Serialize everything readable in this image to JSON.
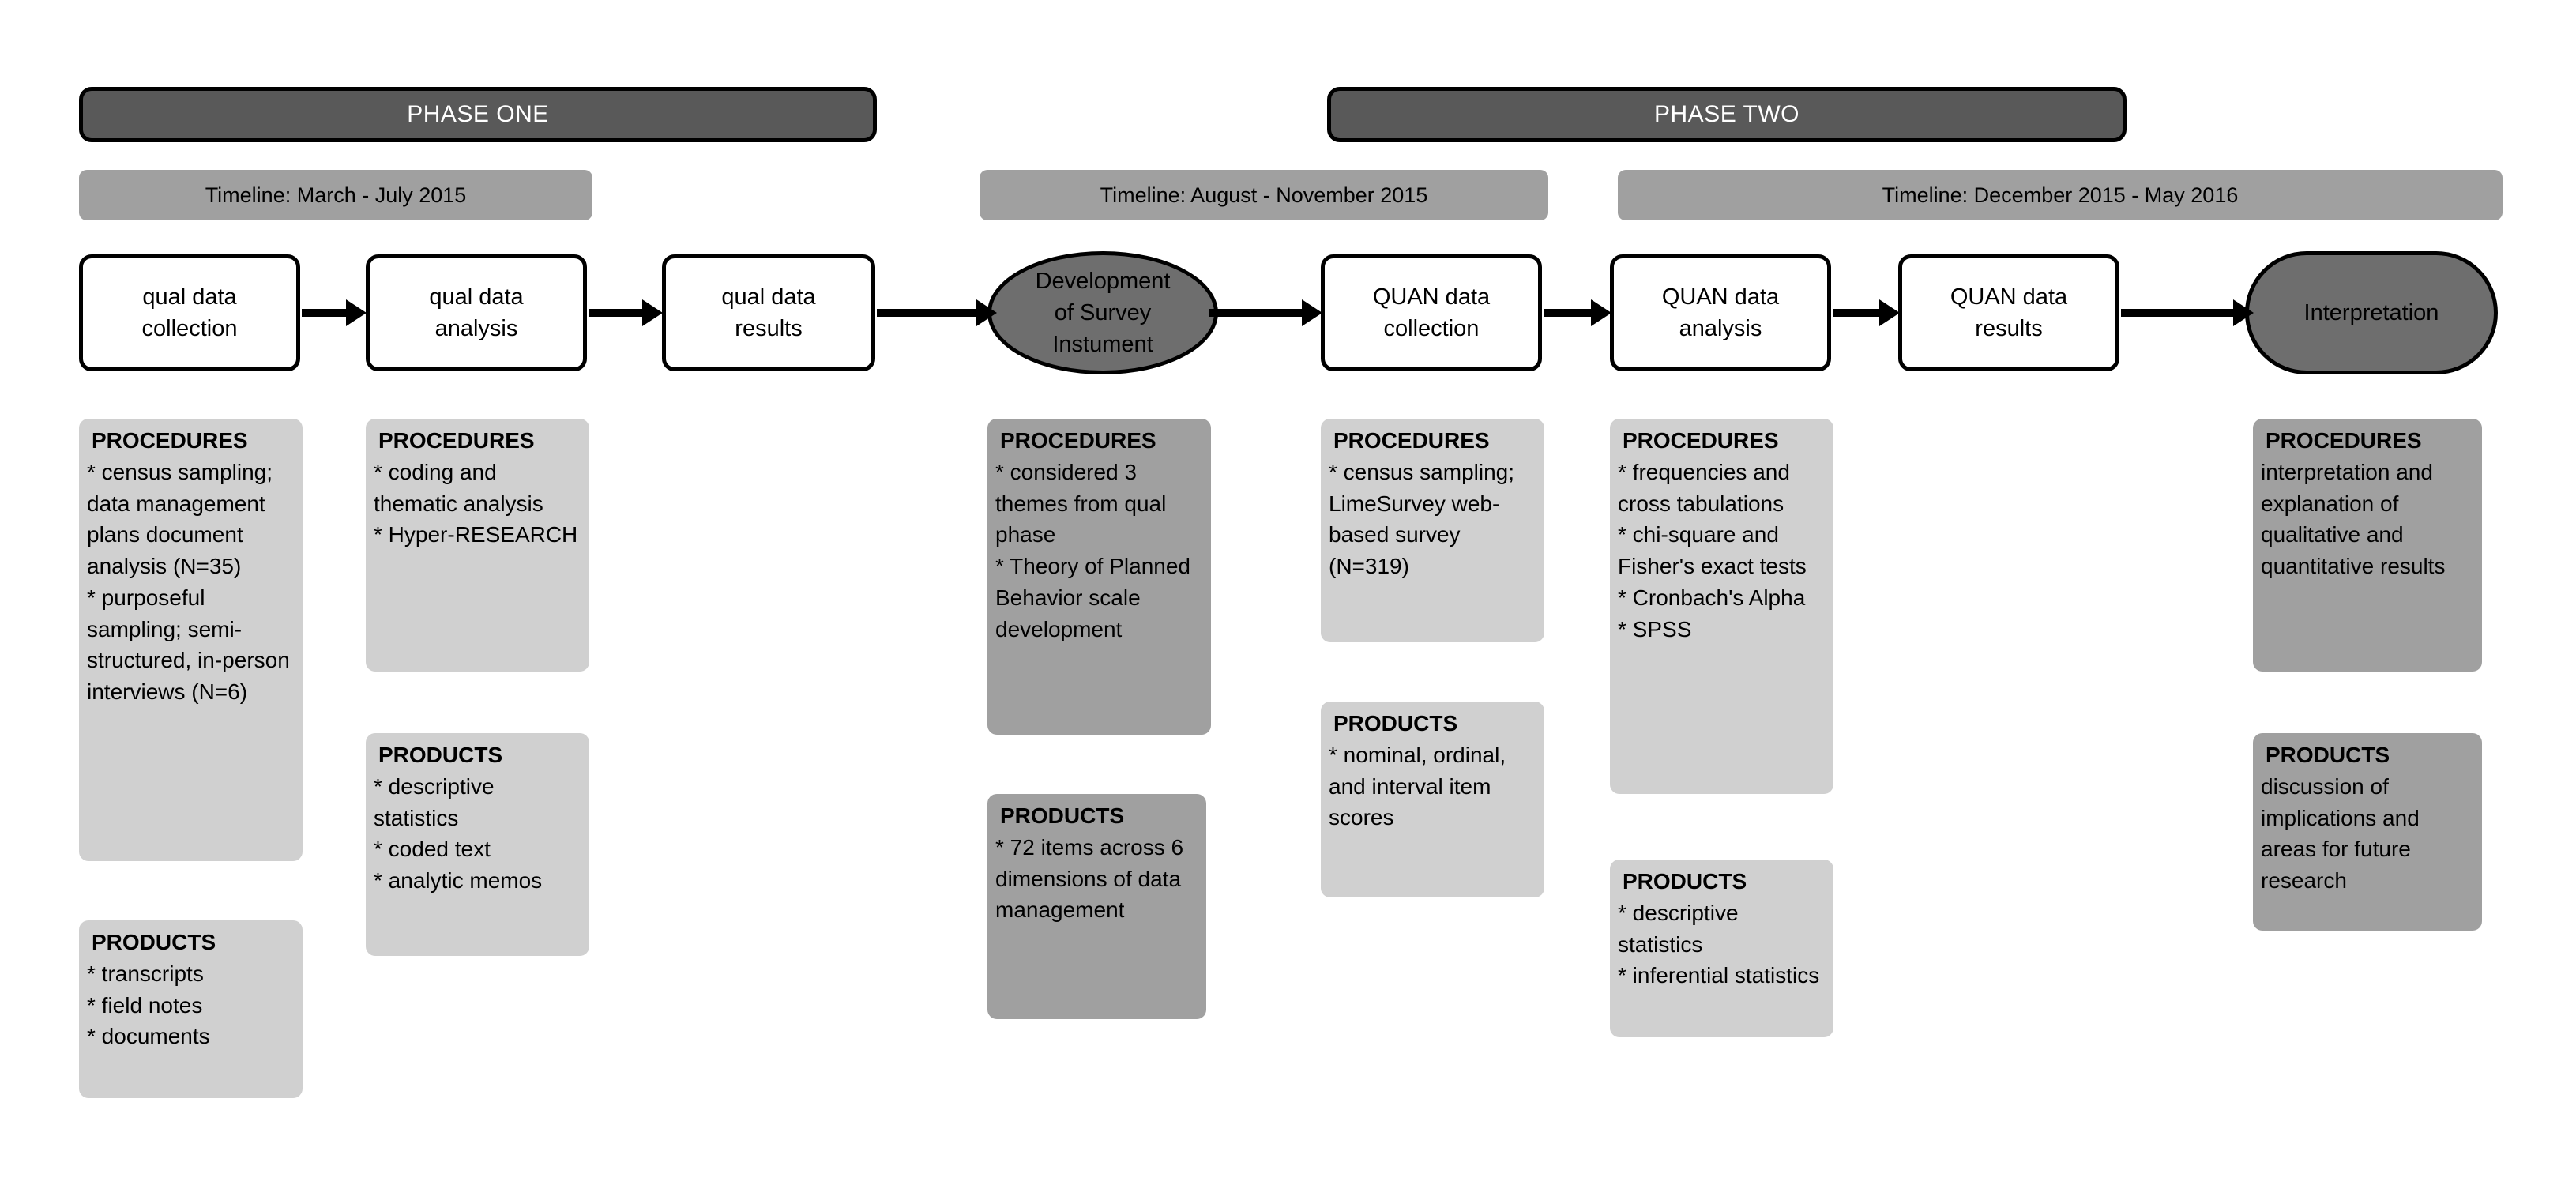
{
  "phases": [
    {
      "label": "PHASE ONE"
    },
    {
      "label": "PHASE TWO"
    }
  ],
  "timelines": [
    {
      "label": "Timeline: March - July 2015"
    },
    {
      "label": "Timeline: August - November 2015"
    },
    {
      "label": "Timeline: December 2015 - May 2016"
    }
  ],
  "nodes": [
    {
      "id": "qual-data-collection",
      "label": "qual data\ncollection",
      "shape": "rect"
    },
    {
      "id": "qual-data-analysis",
      "label": "qual data\nanalysis",
      "shape": "rect"
    },
    {
      "id": "qual-data-results",
      "label": "qual data\nresults",
      "shape": "rect"
    },
    {
      "id": "development-of-survey-instrument",
      "label": "Development\nof Survey\nInstument",
      "shape": "oval"
    },
    {
      "id": "quan-data-collection",
      "label": "QUAN data\ncollection",
      "shape": "rect"
    },
    {
      "id": "quan-data-analysis",
      "label": "QUAN data\nanalysis",
      "shape": "rect"
    },
    {
      "id": "quan-data-results",
      "label": "QUAN data\nresults",
      "shape": "rect"
    },
    {
      "id": "interpretation",
      "label": "Interpretation",
      "shape": "stadium"
    }
  ],
  "cards": {
    "qual_collection_procedures": {
      "title": "PROCEDURES",
      "body": "* census sampling; data management plans document analysis (N=35)\n* purposeful sampling; semi-structured, in-person interviews (N=6)"
    },
    "qual_collection_products": {
      "title": "PRODUCTS",
      "body": "* transcripts\n* field notes\n* documents"
    },
    "qual_analysis_procedures": {
      "title": "PROCEDURES",
      "body": "* coding and thematic analysis\n* Hyper-RESEARCH"
    },
    "qual_analysis_products": {
      "title": "PRODUCTS",
      "body": "* descriptive statistics\n* coded text\n* analytic memos"
    },
    "survey_development_procedures": {
      "title": "PROCEDURES",
      "body": "* considered 3 themes from qual phase\n* Theory of Planned Behavior scale development"
    },
    "survey_development_products": {
      "title": "PRODUCTS",
      "body": "* 72 items across 6 dimensions of data management"
    },
    "quan_collection_procedures": {
      "title": "PROCEDURES",
      "body": "* census sampling; LimeSurvey web-based survey (N=319)"
    },
    "quan_collection_products": {
      "title": "PRODUCTS",
      "body": "* nominal, ordinal, and interval item scores"
    },
    "quan_analysis_procedures": {
      "title": "PROCEDURES",
      "body": "* frequencies and cross tabulations\n* chi-square and Fisher's exact tests\n* Cronbach's Alpha\n* SPSS"
    },
    "quan_analysis_products": {
      "title": "PRODUCTS",
      "body": "* descriptive statistics\n* inferential statistics"
    },
    "interpretation_procedures": {
      "title": "PROCEDURES",
      "body": "interpretation and explanation of qualitative and quantitative results"
    },
    "interpretation_products": {
      "title": "PRODUCTS",
      "body": "discussion of implications and areas for future research"
    }
  },
  "colors": {
    "phase_bar": "#595959",
    "timeline_bar": "#a0a0a0",
    "node_highlight": "#6e6e6e",
    "card_light": "#d0d0d0",
    "card_dark": "#a0a0a0",
    "outline": "#000000"
  }
}
